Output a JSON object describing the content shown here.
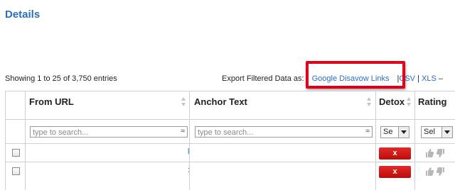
{
  "page": {
    "title": "Details"
  },
  "table_info": {
    "showing": "Showing 1 to 25 of 3,750 entries"
  },
  "export": {
    "label": "Export Filtered Data as:",
    "google_disavow": "Google Disavow Links",
    "sep1": "|",
    "csv": "CSV",
    "sep2": "|",
    "xls": "XLS",
    "trail": "–"
  },
  "columns": {
    "from_url": "From URL",
    "anchor_text": "Anchor Text",
    "detox": "Detox",
    "rating": "Rating"
  },
  "filters": {
    "from_url_placeholder": "type to search...",
    "anchor_text_placeholder": "type to search...",
    "approx_symbol": "≈",
    "detox_select_value": "Se",
    "rating_select_value": "Sel"
  },
  "rows": [
    {
      "link_mark": "l",
      "detox_label": "x"
    },
    {
      "link_mark": ":",
      "detox_label": "x"
    }
  ],
  "colors": {
    "title": "#2a6ebb",
    "link": "#2a6ebb",
    "highlight_border": "#e1001a",
    "detox_button": "#d01212"
  },
  "icons": {
    "thumb_up": "thumb-up-icon",
    "thumb_down": "thumb-down-icon"
  }
}
